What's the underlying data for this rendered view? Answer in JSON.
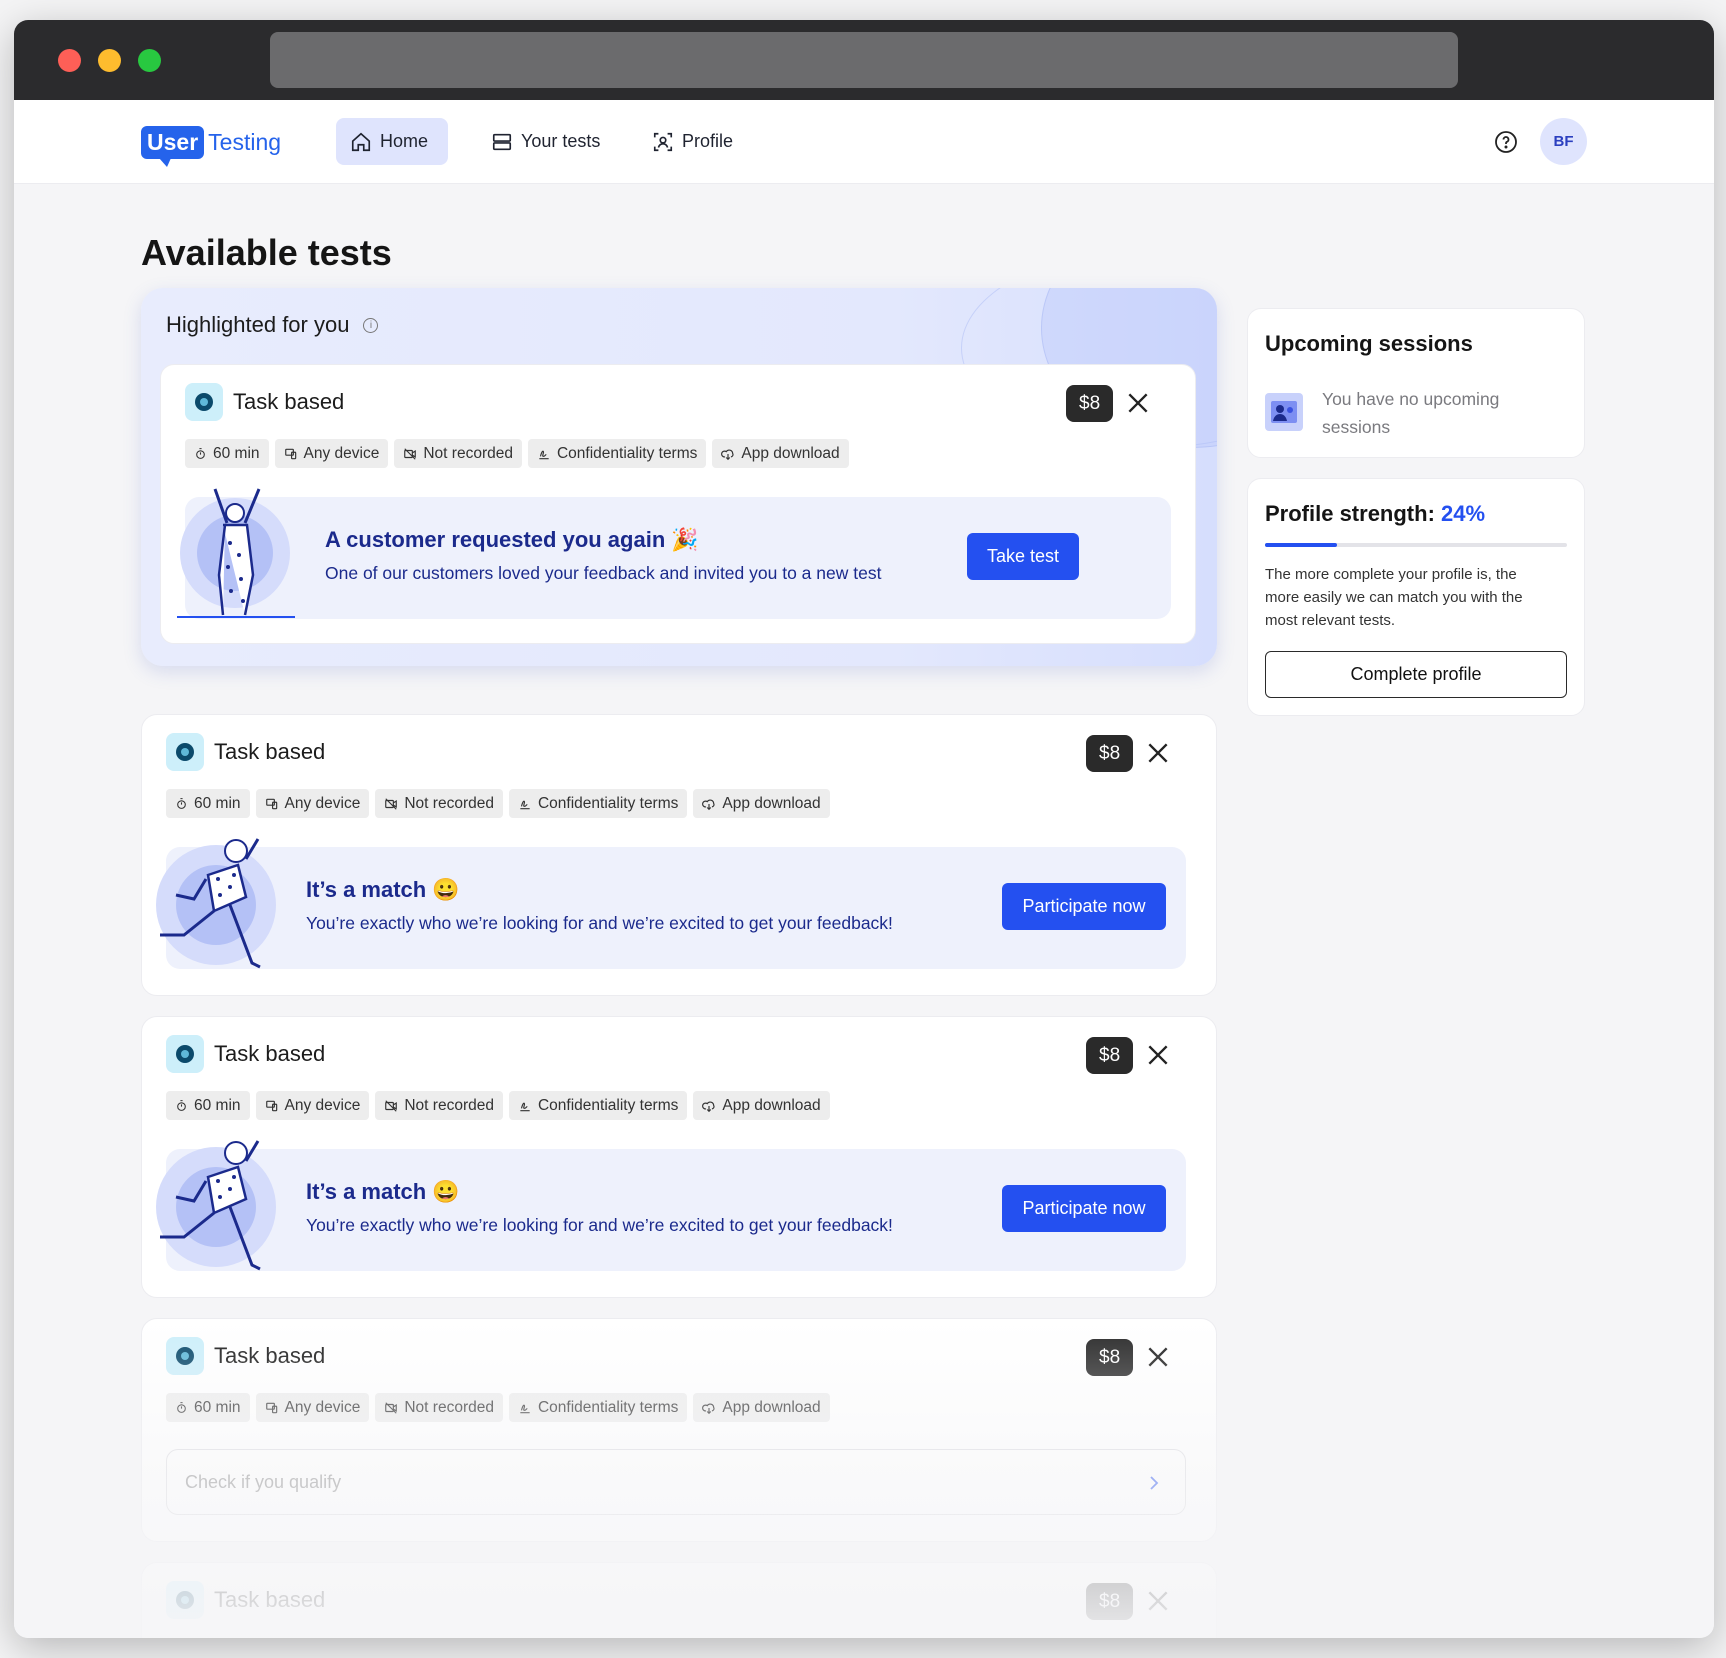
{
  "nav": {
    "logo_user": "User",
    "logo_testing": "Testing",
    "items": [
      {
        "label": "Home",
        "icon": "home-icon",
        "active": true
      },
      {
        "label": "Your tests",
        "icon": "tests-icon",
        "active": false
      },
      {
        "label": "Profile",
        "icon": "profile-icon",
        "active": false
      }
    ],
    "avatar_initials": "BF"
  },
  "page_title": "Available tests",
  "highlighted": {
    "title": "Highlighted for you",
    "info_icon": "i",
    "test": {
      "type": "Task based",
      "price": "$8",
      "tags": [
        "60 min",
        "Any device",
        "Not recorded",
        "Confidentiality terms",
        "App download"
      ],
      "promo_title": "A customer requested you again",
      "promo_emoji": "🎉",
      "promo_subtitle": "One of our customers loved your feedback and invited you to a new test",
      "button": "Take test"
    }
  },
  "tests": [
    {
      "type": "Task based",
      "price": "$8",
      "tags": [
        "60 min",
        "Any device",
        "Not recorded",
        "Confidentiality terms",
        "App download"
      ],
      "promo_title": "It’s a match",
      "promo_emoji": "😀",
      "promo_subtitle": "You’re exactly who we’re looking for and we’re excited to get your feedback!",
      "button": "Participate now"
    },
    {
      "type": "Task based",
      "price": "$8",
      "tags": [
        "60 min",
        "Any device",
        "Not recorded",
        "Confidentiality terms",
        "App download"
      ],
      "promo_title": "It’s a match",
      "promo_emoji": "😀",
      "promo_subtitle": "You’re exactly who we’re looking for and we’re excited to get your feedback!",
      "button": "Participate now"
    },
    {
      "type": "Task based",
      "price": "$8",
      "tags": [
        "60 min",
        "Any device",
        "Not recorded",
        "Confidentiality terms",
        "App download"
      ],
      "qualify_text": "Check if you qualify"
    },
    {
      "type": "Task based",
      "price": "$8"
    }
  ],
  "upcoming": {
    "title": "Upcoming sessions",
    "empty_text": "You have no upcoming sessions"
  },
  "profile_strength": {
    "title": "Profile strength:",
    "percent_label": "24%",
    "percent": 0.24,
    "description": "The more complete your profile is, the more easily we can match you with the most relevant tests.",
    "button": "Complete profile"
  },
  "colors": {
    "accent": "#2450f0",
    "brand": "#2563eb",
    "promo_text": "#1b2a8c"
  }
}
